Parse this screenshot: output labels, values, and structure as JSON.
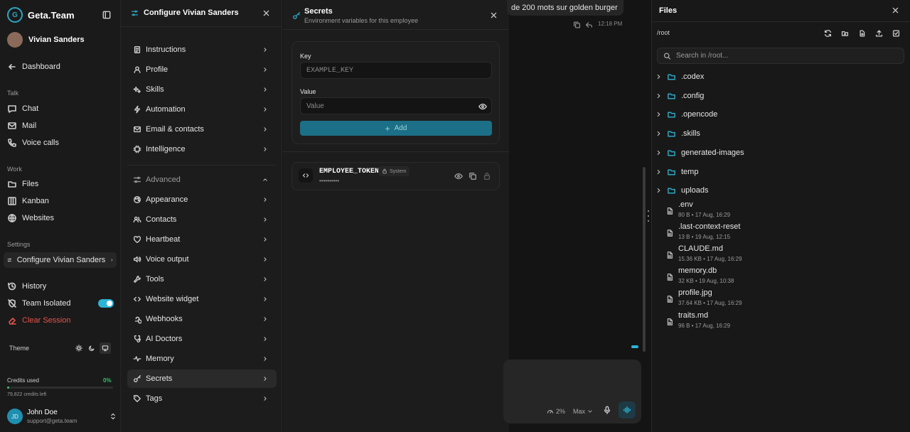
{
  "sidebar": {
    "brand": "Geta.Team",
    "user_name": "Vivian Sanders",
    "dashboard": "Dashboard",
    "talk_label": "Talk",
    "chat": "Chat",
    "mail": "Mail",
    "voice_calls": "Voice calls",
    "work_label": "Work",
    "files": "Files",
    "kanban": "Kanban",
    "websites": "Websites",
    "settings_label": "Settings",
    "configure": "Configure Vivian Sanders",
    "history": "History",
    "team_isolated": "Team Isolated",
    "clear_session": "Clear Session",
    "theme_label": "Theme",
    "credits_label": "Credits used",
    "credits_pct": "0%",
    "credits_fraction": 0.0,
    "credits_left": "79,822 credits left",
    "account_initials": "JD",
    "account_name": "John Doe",
    "account_email": "support@geta.team",
    "team_isolated_on": true
  },
  "config": {
    "title": "Configure Vivian Sanders",
    "items": [
      "Instructions",
      "Profile",
      "Skills",
      "Automation",
      "Email & contacts",
      "Intelligence"
    ],
    "advanced_label": "Advanced",
    "advanced_items": [
      "Appearance",
      "Contacts",
      "Heartbeat",
      "Voice output",
      "Tools",
      "Website widget",
      "Webhooks",
      "AI Doctors",
      "Memory",
      "Secrets",
      "Tags"
    ],
    "selected": "Secrets"
  },
  "secrets": {
    "title": "Secrets",
    "subtitle": "Environment variables for this employee",
    "key_label": "Key",
    "key_placeholder": "EXAMPLE_KEY",
    "value_label": "Value",
    "value_placeholder": "Value",
    "add_label": "Add",
    "token_name": "EMPLOYEE_TOKEN",
    "token_badge": "System",
    "token_mask": "••••••••••"
  },
  "chat": {
    "message": "de 200 mots sur golden burger",
    "time": "12:18 PM",
    "usage": "2%",
    "model": "Max"
  },
  "files": {
    "title": "Files",
    "path": "/root",
    "search_placeholder": "Search in /root...",
    "folders": [
      ".codex",
      ".config",
      ".opencode",
      ".skills",
      "generated-images",
      "temp",
      "uploads"
    ],
    "items": [
      {
        "name": ".env",
        "meta": "80 B • 17 Aug, 16:29"
      },
      {
        "name": ".last-context-reset",
        "meta": "13 B • 19 Aug, 12:15"
      },
      {
        "name": "CLAUDE.md",
        "meta": "15.36 KB • 17 Aug, 16:29"
      },
      {
        "name": "memory.db",
        "meta": "32 KB • 19 Aug, 10:38"
      },
      {
        "name": "profile.jpg",
        "meta": "37.64 KB • 17 Aug, 16:29"
      },
      {
        "name": "traits.md",
        "meta": "96 B • 17 Aug, 16:29"
      }
    ]
  },
  "colors": {
    "accent": "#1b6f86",
    "toggle": "#2bb4d6",
    "danger": "#e5534b",
    "credits": "#35c46a"
  }
}
